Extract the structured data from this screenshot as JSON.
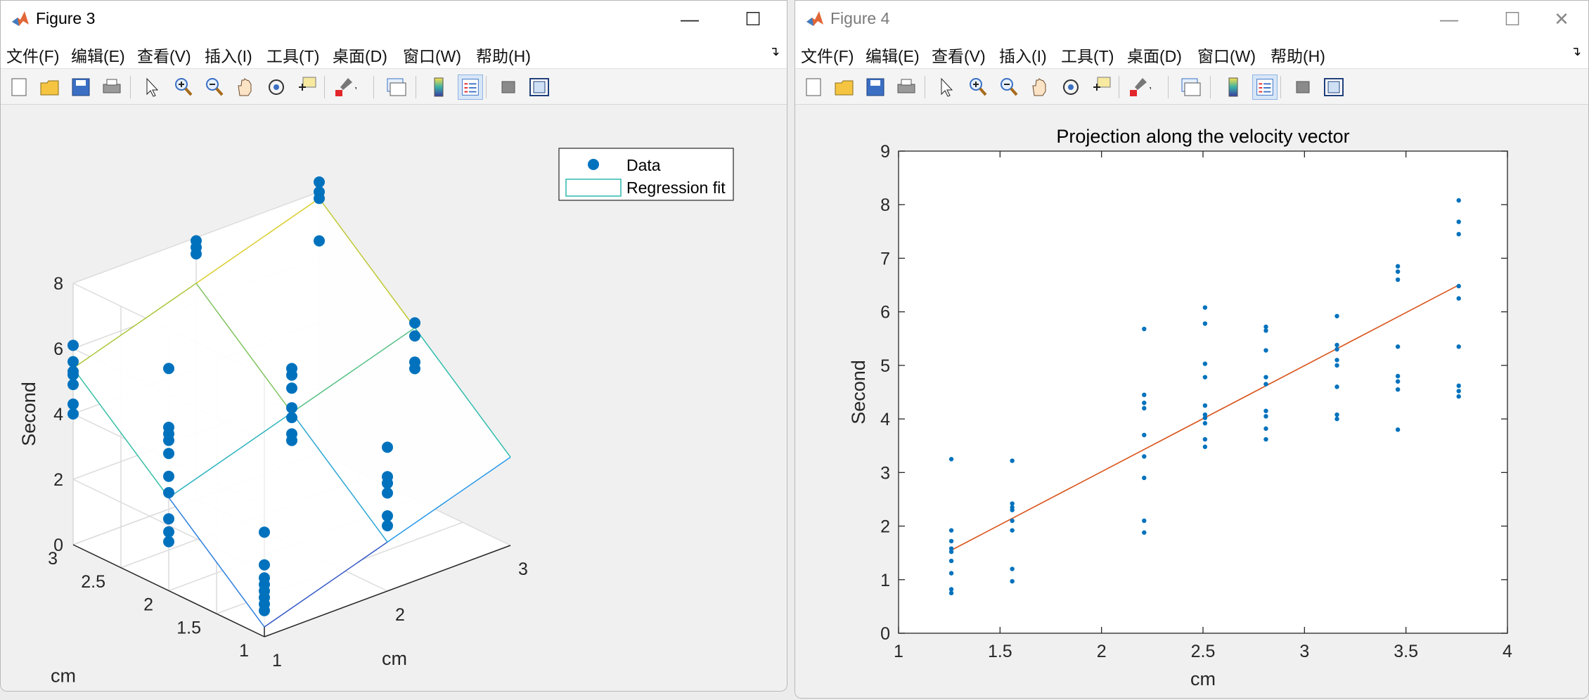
{
  "windows": [
    {
      "id": "win3",
      "title": "Figure 3",
      "menu": [
        "文件(F)",
        "编辑(E)",
        "查看(V)",
        "插入(I)",
        "工具(T)",
        "桌面(D)",
        "窗口(W)",
        "帮助(H)"
      ],
      "controls": {
        "minimize": "—",
        "maximize": "☐",
        "close": "✕"
      }
    },
    {
      "id": "win4",
      "title": "Figure 4",
      "menu": [
        "文件(F)",
        "编辑(E)",
        "查看(V)",
        "插入(I)",
        "工具(T)",
        "桌面(D)",
        "窗口(W)",
        "帮助(H)"
      ],
      "controls": {
        "minimize": "—",
        "maximize": "☐",
        "close": "✕"
      }
    }
  ],
  "toolbar_icons": [
    "new-figure-icon",
    "open-file-icon",
    "save-icon",
    "print-icon",
    "pointer-icon",
    "zoom-in-icon",
    "zoom-out-icon",
    "pan-hand-icon",
    "rotate-3d-icon",
    "data-cursor-icon",
    "brush-icon",
    "link-plot-icon",
    "colorbar-icon",
    "legend-icon",
    "hide-plot-tools-icon",
    "show-plot-tools-icon"
  ],
  "colors": {
    "data": "#0072bd",
    "fit_line": "#d95319"
  },
  "chart_data": [
    {
      "type": "scatter",
      "subtype": "3d-scatter-with-regression-surface",
      "title": "",
      "xlabel": "cm",
      "ylabel": "cm",
      "zlabel": "Second",
      "xlim": [
        1,
        3
      ],
      "ylim": [
        1,
        3
      ],
      "zlim": [
        0,
        8
      ],
      "xticks": [
        "1",
        "2",
        "3"
      ],
      "yticks": [
        "1",
        "1.5",
        "2",
        "2.5",
        "3"
      ],
      "zticks": [
        "0",
        "2",
        "4",
        "6",
        "8"
      ],
      "grid": true,
      "legend": {
        "placement": "top-right",
        "entries": [
          "Data",
          "Regression fit"
        ]
      },
      "series": [
        {
          "name": "Data",
          "points": [
            {
              "x": 1,
              "y": 1,
              "z": [
                0.8,
                1.0,
                1.2,
                1.4,
                1.6,
                1.8,
                2.2,
                3.2
              ]
            },
            {
              "x": 1,
              "y": 2,
              "z": [
                1.5,
                1.8,
                2.2,
                3.0,
                3.5,
                4.2,
                4.6,
                4.8,
                5.0,
                6.8
              ]
            },
            {
              "x": 1,
              "y": 3,
              "z": [
                4.0,
                4.3,
                4.9,
                5.2,
                5.3,
                5.6,
                6.1
              ]
            },
            {
              "x": 2,
              "y": 1,
              "z": [
                2.0,
                2.3,
                3.0,
                3.3,
                3.5,
                4.4
              ]
            },
            {
              "x": 2,
              "y": 2,
              "z": [
                3.2,
                3.4,
                3.9,
                4.2,
                4.8,
                5.2,
                5.4
              ]
            },
            {
              "x": 2,
              "y": 3,
              "z": [
                7.5,
                7.7,
                7.9
              ]
            },
            {
              "x": 3,
              "y": 3,
              "z": [
                6.5,
                7.8,
                8.0,
                8.3
              ]
            },
            {
              "x": 3,
              "y": 2,
              "z": [
                4.0,
                4.2,
                5.0,
                5.4
              ]
            }
          ]
        }
      ],
      "fit_surface": {
        "name": "Regression fit",
        "corners": [
          {
            "x": 1,
            "y": 1,
            "z": 0.3
          },
          {
            "x": 3,
            "y": 1,
            "z": 2.7
          },
          {
            "x": 1,
            "y": 3,
            "z": 5.4
          },
          {
            "x": 3,
            "y": 3,
            "z": 7.8
          }
        ]
      }
    },
    {
      "type": "scatter",
      "title": "Projection along the velocity vector",
      "xlabel": "cm",
      "ylabel": "Second",
      "xlim": [
        1,
        4
      ],
      "ylim": [
        0,
        9
      ],
      "xticks": [
        "1",
        "1.5",
        "2",
        "2.5",
        "3",
        "3.5",
        "4"
      ],
      "yticks": [
        "0",
        "1",
        "2",
        "3",
        "4",
        "5",
        "6",
        "7",
        "8",
        "9"
      ],
      "grid": false,
      "series": [
        {
          "points": [
            [
              1.26,
              0.75
            ],
            [
              1.26,
              0.82
            ],
            [
              1.26,
              1.12
            ],
            [
              1.26,
              1.35
            ],
            [
              1.26,
              1.52
            ],
            [
              1.26,
              1.58
            ],
            [
              1.26,
              1.72
            ],
            [
              1.26,
              1.92
            ],
            [
              1.26,
              3.25
            ],
            [
              1.56,
              0.97
            ],
            [
              1.56,
              1.2
            ],
            [
              1.56,
              1.92
            ],
            [
              1.56,
              2.1
            ],
            [
              1.56,
              2.3
            ],
            [
              1.56,
              2.35
            ],
            [
              1.56,
              2.42
            ],
            [
              1.56,
              3.22
            ],
            [
              2.21,
              1.88
            ],
            [
              2.21,
              2.1
            ],
            [
              2.21,
              2.9
            ],
            [
              2.21,
              3.3
            ],
            [
              2.21,
              3.7
            ],
            [
              2.21,
              4.2
            ],
            [
              2.21,
              4.3
            ],
            [
              2.21,
              4.45
            ],
            [
              2.21,
              5.68
            ],
            [
              2.51,
              3.48
            ],
            [
              2.51,
              3.62
            ],
            [
              2.51,
              3.92
            ],
            [
              2.51,
              4.02
            ],
            [
              2.51,
              4.08
            ],
            [
              2.51,
              4.25
            ],
            [
              2.51,
              4.78
            ],
            [
              2.51,
              5.03
            ],
            [
              2.51,
              5.78
            ],
            [
              2.51,
              6.08
            ],
            [
              2.81,
              3.62
            ],
            [
              2.81,
              3.82
            ],
            [
              2.81,
              4.05
            ],
            [
              2.81,
              4.15
            ],
            [
              2.81,
              4.65
            ],
            [
              2.81,
              4.78
            ],
            [
              2.81,
              5.28
            ],
            [
              2.81,
              5.65
            ],
            [
              2.81,
              5.72
            ],
            [
              3.16,
              4.0
            ],
            [
              3.16,
              4.08
            ],
            [
              3.16,
              4.6
            ],
            [
              3.16,
              5.0
            ],
            [
              3.16,
              5.1
            ],
            [
              3.16,
              5.3
            ],
            [
              3.16,
              5.38
            ],
            [
              3.16,
              5.92
            ],
            [
              3.46,
              3.8
            ],
            [
              3.46,
              4.55
            ],
            [
              3.46,
              4.7
            ],
            [
              3.46,
              4.8
            ],
            [
              3.46,
              5.35
            ],
            [
              3.46,
              6.6
            ],
            [
              3.46,
              6.75
            ],
            [
              3.46,
              6.85
            ],
            [
              3.76,
              4.42
            ],
            [
              3.76,
              4.52
            ],
            [
              3.76,
              4.62
            ],
            [
              3.76,
              5.35
            ],
            [
              3.76,
              6.25
            ],
            [
              3.76,
              6.48
            ],
            [
              3.76,
              7.45
            ],
            [
              3.76,
              7.68
            ],
            [
              3.76,
              8.08
            ]
          ]
        },
        {
          "type": "line",
          "points": [
            [
              1.26,
              1.55
            ],
            [
              3.76,
              6.5
            ]
          ]
        }
      ]
    }
  ]
}
